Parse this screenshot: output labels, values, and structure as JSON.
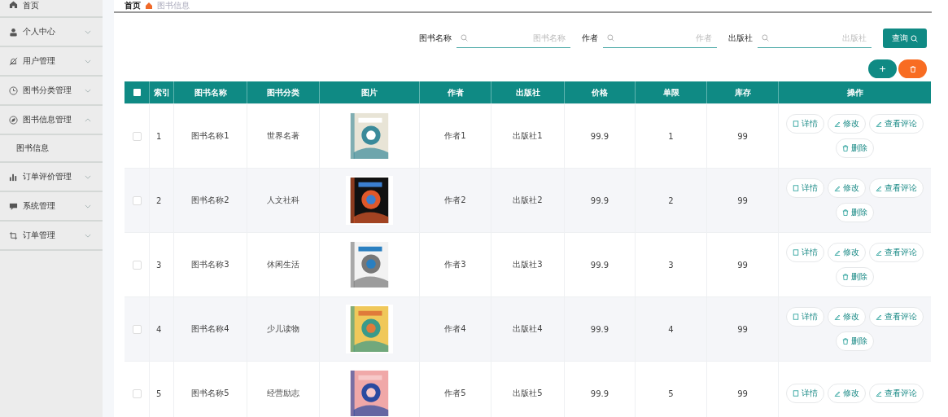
{
  "sidebar": {
    "items": [
      {
        "label": "首页"
      },
      {
        "label": "个人中心",
        "expanded": false
      },
      {
        "label": "用户管理",
        "expanded": false
      },
      {
        "label": "图书分类管理",
        "expanded": false
      },
      {
        "label": "图书信息管理",
        "expanded": true,
        "children": [
          {
            "label": "图书信息"
          }
        ]
      },
      {
        "label": "订单评价管理",
        "expanded": false
      },
      {
        "label": "系统管理",
        "expanded": false
      },
      {
        "label": "订单管理",
        "expanded": false
      }
    ]
  },
  "breadcrumb": [
    {
      "label": "首页"
    },
    {
      "label": "图书信息"
    }
  ],
  "search": {
    "fields": [
      {
        "label": "图书名称",
        "placeholder": "图书名称"
      },
      {
        "label": "作者",
        "placeholder": "作者"
      },
      {
        "label": "出版社",
        "placeholder": "出版社"
      }
    ],
    "button": "查询"
  },
  "actions": {
    "add": "+"
  },
  "table": {
    "select_all": {
      "checked": false
    },
    "columns": [
      "索引",
      "图书名称",
      "图书分类",
      "图片",
      "作者",
      "出版社",
      "价格",
      "单限",
      "库存",
      "操作"
    ],
    "rows": [
      {
        "checked": false,
        "cells": [
          "1",
          "图书名称1",
          "世界名著",
          {
            "kind": "picture"
          },
          "作者1",
          "出版社1",
          "99.9",
          "1",
          "99"
        ],
        "buttons": [
          "详情",
          "修改",
          "查看评论",
          "删除"
        ]
      },
      {
        "checked": false,
        "cells": [
          "2",
          "图书名称2",
          "人文社科",
          {
            "kind": "picture"
          },
          "作者2",
          "出版社2",
          "99.9",
          "2",
          "99"
        ],
        "buttons": [
          "详情",
          "修改",
          "查看评论",
          "删除"
        ]
      },
      {
        "checked": false,
        "cells": [
          "3",
          "图书名称3",
          "休闲生活",
          {
            "kind": "picture"
          },
          "作者3",
          "出版社3",
          "99.9",
          "3",
          "99"
        ],
        "buttons": [
          "详情",
          "修改",
          "查看评论",
          "删除"
        ]
      },
      {
        "checked": false,
        "cells": [
          "4",
          "图书名称4",
          "少儿读物",
          {
            "kind": "picture"
          },
          "作者4",
          "出版社4",
          "99.9",
          "4",
          "99"
        ],
        "buttons": [
          "详情",
          "修改",
          "查看评论",
          "删除"
        ]
      },
      {
        "checked": false,
        "cells": [
          "5",
          "图书名称5",
          "经营励志",
          {
            "kind": "picture"
          },
          "作者5",
          "出版社5",
          "99.9",
          "5",
          "99"
        ],
        "buttons": [
          "详情",
          "修改",
          "查看评论"
        ]
      }
    ]
  }
}
